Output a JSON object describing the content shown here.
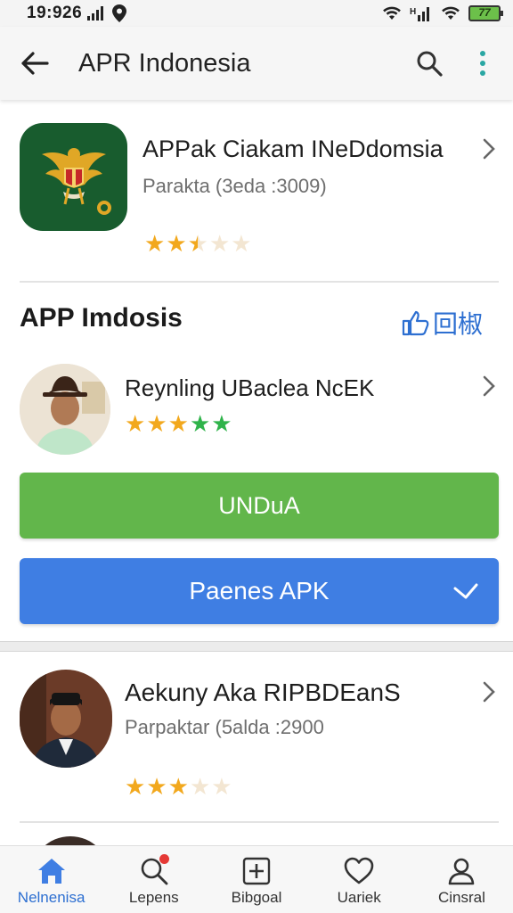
{
  "status_bar": {
    "time": "19:926",
    "icons": [
      "signal-icon",
      "location-icon",
      "wifi-icon",
      "data-signal-icon",
      "wifi-icon",
      "battery-icon"
    ],
    "battery_label": "77"
  },
  "app_bar": {
    "title": "APR Indonesia",
    "back_icon": "back-arrow-icon",
    "search_icon": "search-icon",
    "menu_icon": "more-vert-icon"
  },
  "featured_app": {
    "title": "APPak Ciakam INeDdomsia",
    "subtitle": "Parakta  (3eda :3009)",
    "icon": "garuda-emblem-icon",
    "rating": 2.5,
    "star_count": 5
  },
  "section": {
    "title": "APP Imdosis",
    "action_label": "回椒",
    "action_icon": "thumbs-up-icon"
  },
  "developer": {
    "name": "Reynling UBaclea NcEK",
    "rating": 5,
    "stars": [
      "full",
      "full",
      "full",
      "green",
      "green"
    ]
  },
  "buttons": {
    "download_label": "UNDuA",
    "apk_label": "Paenes APK",
    "apk_icon": "check-icon"
  },
  "second_app": {
    "title": "Aekuny Aka RIPBDEanS",
    "subtitle": "Parpaktar  (5alda :2900",
    "rating": 3,
    "star_count": 5
  },
  "bottom_nav": {
    "items": [
      {
        "label": "Nelnenisa",
        "icon": "home-icon",
        "active": true
      },
      {
        "label": "Lepens",
        "icon": "search-icon",
        "active": false,
        "badge": true
      },
      {
        "label": "Bibgoal",
        "icon": "plus-box-icon",
        "active": false
      },
      {
        "label": "Uariek",
        "icon": "heart-icon",
        "active": false
      },
      {
        "label": "Cinsral",
        "icon": "person-icon",
        "active": false
      }
    ]
  },
  "colors": {
    "accent_blue": "#3f7ee3",
    "download_green": "#62b64b",
    "star_gold": "#f2a81d",
    "emblem_bg": "#185c2e"
  }
}
